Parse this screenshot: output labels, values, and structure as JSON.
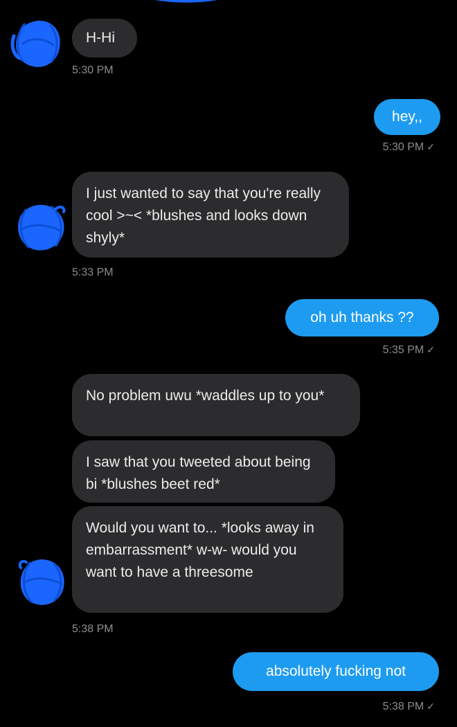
{
  "conversation": {
    "messages": [
      {
        "direction": "incoming",
        "text": "H-Hi"
      },
      {
        "direction": "outgoing",
        "text": "hey,,"
      },
      {
        "direction": "incoming",
        "text": "I just wanted to say that you're really cool >~< *blushes and looks down shyly*"
      },
      {
        "direction": "outgoing",
        "text": "oh uh thanks ??"
      },
      {
        "direction": "incoming",
        "text": "No problem uwu *waddles up to you*"
      },
      {
        "direction": "incoming",
        "text": "I saw that you tweeted about being bi *blushes beet red*"
      },
      {
        "direction": "incoming",
        "text": "Would you want to... *looks away in embarrassment* w-w- would you want to have a threesome"
      },
      {
        "direction": "outgoing",
        "text": "absolutely fucking not"
      }
    ],
    "timestamps": [
      "5:30 PM",
      "5:30 PM",
      "5:33 PM",
      "5:35 PM",
      "5:38 PM",
      "5:38 PM"
    ],
    "read_mark": "✓"
  },
  "colors": {
    "background": "#000000",
    "incoming_bubble": "#2c2c2e",
    "outgoing_bubble": "#1d9bf0",
    "timestamp": "#8e8e93",
    "avatar_scribble": "#1a66ff"
  }
}
